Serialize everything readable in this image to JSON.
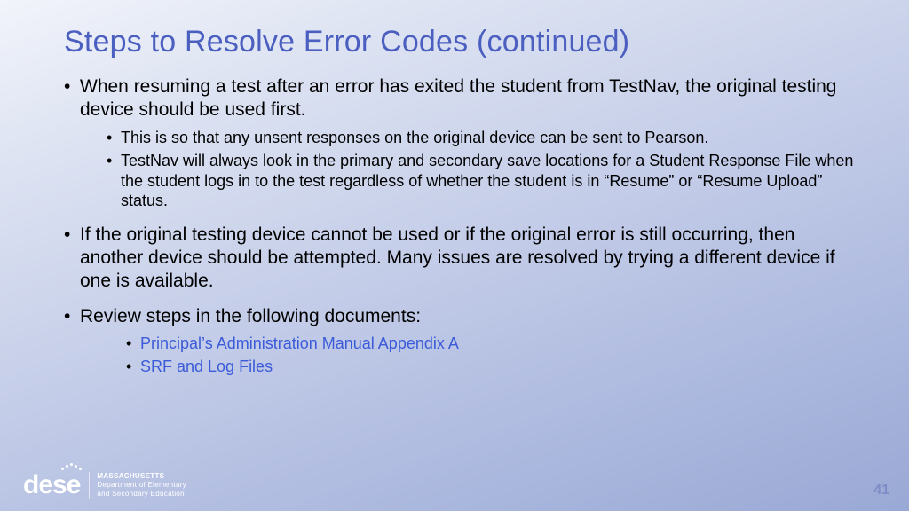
{
  "title": "Steps to Resolve Error Codes (continued)",
  "bullets": {
    "b1": "When resuming a test after an error has exited the student from TestNav, the original testing device should be used first.",
    "b1_sub": {
      "s1": "This is so that any unsent responses on the original device can be sent to Pearson.",
      "s2": "TestNav will always look in the primary and secondary save locations for a Student Response File when the student logs in to the test regardless of whether the student is in “Resume” or “Resume Upload” status."
    },
    "b2": "If the original testing device cannot be used or if the original error is still occurring, then another device should be attempted. Many issues are resolved by trying a different device if one is available.",
    "b3": "Review steps in the following documents:",
    "b3_links": {
      "l1": "Principal’s Administration Manual Appendix A",
      "l2": "SRF and Log Files"
    }
  },
  "footer": {
    "page_number": "41",
    "logo_mark": "dese",
    "logo_line1": "MASSACHUSETTS",
    "logo_line2": "Department of Elementary",
    "logo_line3": "and Secondary Education"
  }
}
